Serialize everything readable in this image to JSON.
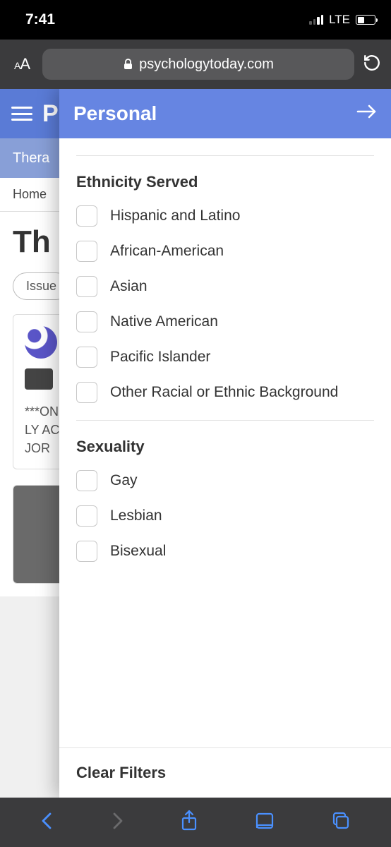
{
  "status_bar": {
    "time": "7:41",
    "network": "LTE"
  },
  "browser": {
    "domain": "psychologytoday.com"
  },
  "background": {
    "tab_label": "Thera",
    "breadcrumb_home": "Home",
    "page_title_fragment": "Th",
    "filter_chip_fragment": "Issue",
    "card_text_line1": "***ON",
    "card_text_line2": "LY AC",
    "card_text_line3": "JOR"
  },
  "panel": {
    "title": "Personal",
    "sections": [
      {
        "title": "Ethnicity Served",
        "options": [
          "Hispanic and Latino",
          "African-American",
          "Asian",
          "Native American",
          "Pacific Islander",
          "Other Racial or Ethnic Background"
        ]
      },
      {
        "title": "Sexuality",
        "options": [
          "Gay",
          "Lesbian",
          "Bisexual"
        ]
      }
    ],
    "clear_label": "Clear Filters"
  }
}
